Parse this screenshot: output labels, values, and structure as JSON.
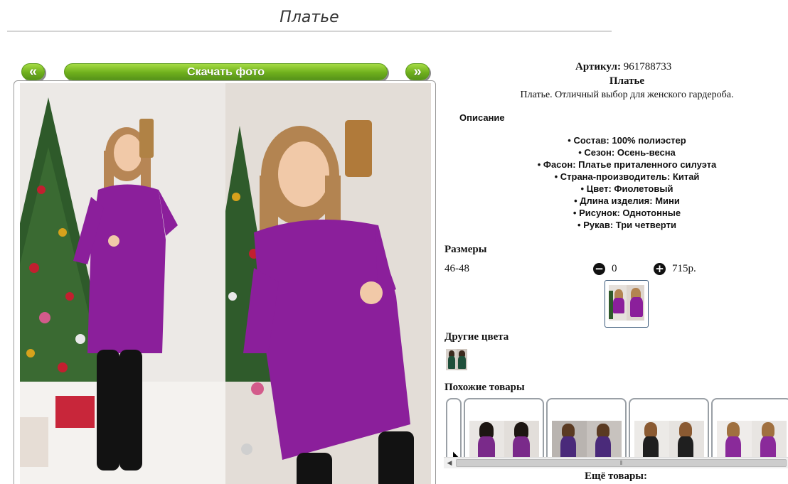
{
  "page": {
    "title": "Платье"
  },
  "gallery": {
    "prev_label": "«",
    "download_label": "Скачать фото",
    "next_label": "»"
  },
  "product": {
    "article_label": "Артикул:",
    "article_value": "961788733",
    "name": "Платье",
    "description": "Платье. Отличный выбор для женского гардероба.",
    "desc_heading": "Описание",
    "properties": [
      "Состав: 100% полиэстер",
      "Сезон: Осень-весна",
      "Фасон: Платье приталенного силуэта",
      "Страна-производитель: Китай",
      "Цвет: Фиолетовый",
      "Длина изделия: Мини",
      "Рисунок: Однотонные",
      "Рукав: Три четверти"
    ]
  },
  "sizes": {
    "heading": "Размеры",
    "row_label": "46-48",
    "quantity": "0",
    "price": "715р."
  },
  "other_colors": {
    "heading": "Другие цвета"
  },
  "similar": {
    "heading": "Похожие товары",
    "items": [
      {
        "dress_color": "#7a2a8a"
      },
      {
        "dress_color": "#4a2a7a"
      },
      {
        "dress_color": "#1f1f1f"
      },
      {
        "dress_color": "#8a2a9a"
      }
    ]
  },
  "scrollbar_label": "⦀",
  "more_label": "Ещё товары:",
  "colors": {
    "button_green": "#6fb01c",
    "dress_purple": "#8b1f9b",
    "border_gray": "#9aa0a6"
  }
}
